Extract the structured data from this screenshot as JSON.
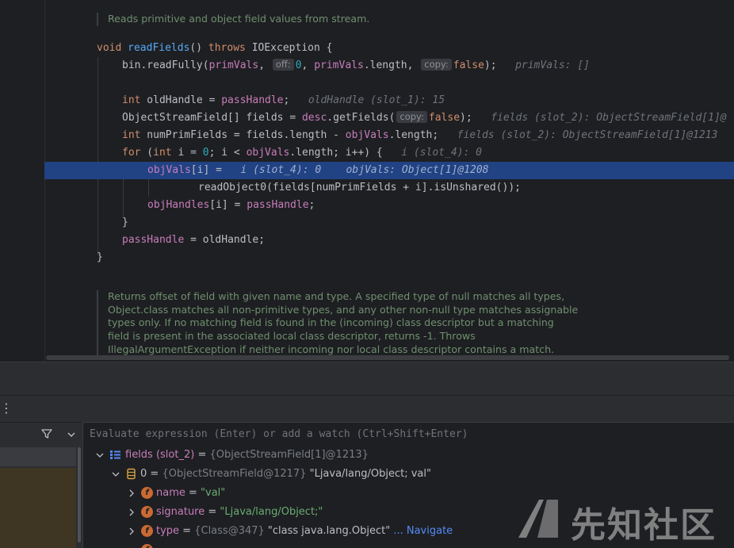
{
  "editor": {
    "doc_comment_top": "Reads primitive and object field values from stream.",
    "lines": {
      "l1": {
        "kw1": "void",
        "fn": "readFields",
        "mid": "() ",
        "kw2": "throws",
        "rest": " IOException {"
      },
      "l2": {
        "a": "bin.readFully(",
        "b": "primVals",
        "c": ",",
        "chip1": "off:",
        "d": "0",
        "e": ", ",
        "f": "primVals",
        "g": ".length,",
        "chip2": "copy:",
        "h": "false",
        "i": ");",
        "hint": "primVals: []"
      },
      "l3": {
        "kw": "int",
        "a": " oldHandle = ",
        "b": "passHandle",
        "c": ";",
        "hint": "oldHandle (slot_1): 15"
      },
      "l4": {
        "a": "ObjectStreamField[] fields = ",
        "b": "desc",
        "c": ".getFields(",
        "chip": "copy:",
        "d": "false",
        "e": ");",
        "hint": "fields (slot_2): ObjectStreamField[1]@"
      },
      "l5": {
        "kw": "int",
        "a": " numPrimFields = fields.length - ",
        "b": "objVals",
        "c": ".length;",
        "hint": "fields (slot_2): ObjectStreamField[1]@1213"
      },
      "l6": {
        "kw1": "for",
        "a": " (",
        "kw2": "int",
        "b": " i = ",
        "n": "0",
        "c": "; i < ",
        "d": "objVals",
        "e": ".length; i++) {",
        "hint": "i (slot_4): 0"
      },
      "l7": {
        "a": "objVals",
        "b": "[i] = ",
        "hint1": "i (slot_4): 0",
        "hint2": "objVals: Object[1]@1208"
      },
      "l8": {
        "a": "readObject0(fields[numPrimFields + i].isUnshared());"
      },
      "l9": {
        "a": "objHandles",
        "b": "[i] = ",
        "c": "passHandle",
        "d": ";"
      },
      "l10": {
        "a": "}"
      },
      "l11": {
        "a": "passHandle",
        "b": " = oldHandle;"
      },
      "l12": {
        "a": "}"
      }
    },
    "doc_comment_bottom": [
      "Returns offset of field with given name and type. A specified type of null matches all types,",
      "Object.class matches all non-primitive types, and any other non-null type matches assignable",
      "types only. If no matching field is found in the (incoming) class descriptor but a matching",
      "field is present in the associated local class descriptor, returns -1. Throws",
      "IllegalArgumentException if neither incoming nor local class descriptor contains a match."
    ]
  },
  "debug": {
    "more_icon": "⋮",
    "eval_placeholder": "Evaluate expression (Enter) or add a watch (Ctrl+Shift+Enter)",
    "vars": [
      {
        "name": "fields (slot_2)",
        "eq": " = ",
        "type": "{ObjectStreamField[1]@1213}"
      },
      {
        "name": "0",
        "eq": " = ",
        "type": "{ObjectStreamField@1217}",
        "value": " \"Ljava/lang/Object; val\""
      },
      {
        "name": "name",
        "eq": " = ",
        "value": "\"val\""
      },
      {
        "name": "signature",
        "eq": " = ",
        "value": "\"Ljava/lang/Object;\""
      },
      {
        "name": "type",
        "eq": " = ",
        "type": "{Class@347}",
        "value": " \"class java.lang.Object\"",
        "link": " ... Navigate"
      }
    ],
    "field_icon_letter": "f"
  },
  "watermark": {
    "text": "先知社区"
  },
  "colors": {
    "highlight": "#214283",
    "keyword": "#cf8e6d",
    "function": "#56a8f5",
    "field": "#c77dbb",
    "number": "#2aacb8",
    "string": "#6aab73",
    "link": "#548af7"
  }
}
